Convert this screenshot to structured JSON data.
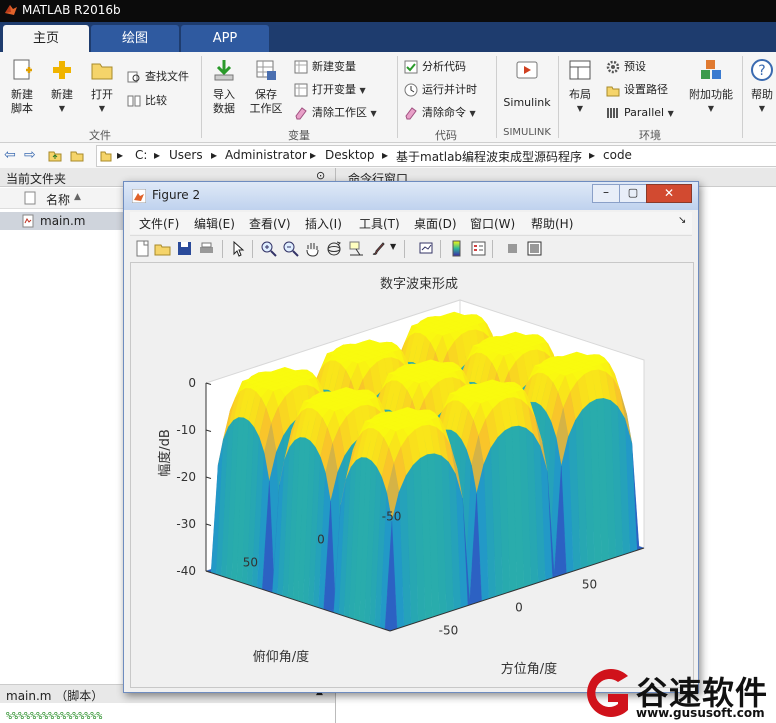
{
  "app": {
    "title": "MATLAB R2016b"
  },
  "tabs": [
    {
      "label": "主页",
      "active": true
    },
    {
      "label": "绘图"
    },
    {
      "label": "APP"
    }
  ],
  "ribbon": {
    "file": {
      "new_script": [
        "新建",
        "脚本"
      ],
      "new": "新建",
      "open": "打开",
      "find_files": "查找文件",
      "compare": "比较",
      "group": "文件"
    },
    "variable": {
      "import": [
        "导入",
        "数据"
      ],
      "save_ws": [
        "保存",
        "工作区"
      ],
      "new_var": "新建变量",
      "open_var": "打开变量",
      "clear_ws": "清除工作区",
      "group": "变量"
    },
    "code": {
      "analyze": "分析代码",
      "run_time": "运行并计时",
      "clear_cmd": "清除命令",
      "group": "代码"
    },
    "simulink": {
      "label": "Simulink",
      "group": "SIMULINK"
    },
    "env": {
      "layout": "布局",
      "prefs": "预设",
      "set_path": "设置路径",
      "parallel": "Parallel",
      "group": "环境"
    },
    "addons": "附加功能",
    "help": "帮助"
  },
  "address": {
    "path": [
      "C:",
      "Users",
      "Administrator",
      "Desktop",
      "基于matlab编程波束成型源码程序",
      "code"
    ]
  },
  "current_folder": {
    "title": "当前文件夹",
    "col_name": "名称",
    "files": [
      "main.m"
    ],
    "detail": "main.m （脚本）",
    "preview": "%%%%%%%%%%%%%%%%"
  },
  "command_window": {
    "title": "命令行窗口"
  },
  "figure": {
    "title": "Figure 2",
    "menus": [
      "文件(F)",
      "编辑(E)",
      "查看(V)",
      "插入(I)",
      "工具(T)",
      "桌面(D)",
      "窗口(W)",
      "帮助(H)"
    ]
  },
  "chart_data": {
    "type": "surface",
    "title": "数字波束形成",
    "zlabel": "幅度/dB",
    "xlabel": "方位角/度",
    "ylabel": "俯仰角/度",
    "zticks": [
      "0",
      "-10",
      "-20",
      "-30",
      "-40"
    ],
    "xticks": [
      "-50",
      "0",
      "50"
    ],
    "yticks": [
      "50",
      "0",
      "-50"
    ],
    "zlim": [
      -40,
      0
    ],
    "xlim": [
      -90,
      90
    ],
    "ylim": [
      -90,
      90
    ],
    "colormap": "parula",
    "colors": [
      "#3e26a8",
      "#1e8ed8",
      "#2db89a",
      "#f9b234",
      "#f9fb0e"
    ]
  },
  "watermark": {
    "name": "谷速软件",
    "url": "www.gususoft.com"
  }
}
